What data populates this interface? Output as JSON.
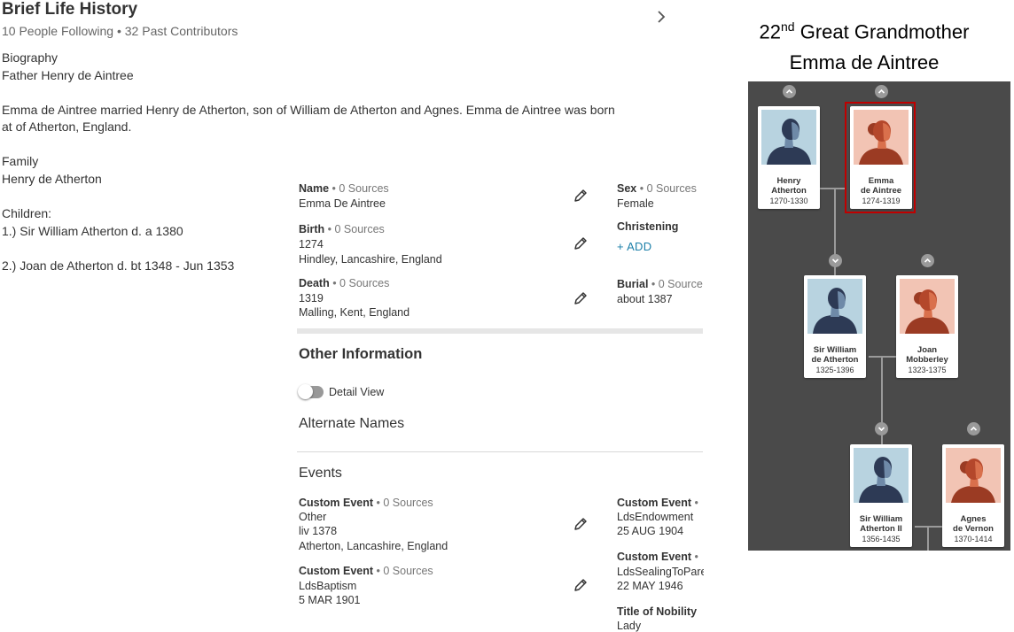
{
  "header": {
    "title": "Brief Life History",
    "subtitle": "10 People Following • 32 Past Contributors"
  },
  "bio": {
    "lines": [
      "Biography",
      "Father Henry de Aintree",
      "Emma de Aintree married Henry de Atherton, son of William de Atherton and Agnes. Emma de Aintree was born",
      "at of Atherton, England.",
      "Family",
      "Henry de Atherton",
      "Children:",
      "1.) Sir William Atherton d. a 1380",
      "2.) Joan de Atherton d. bt 1348 - Jun 1353"
    ]
  },
  "vitals": {
    "name": {
      "label": "Name",
      "sources": " • 0 Sources",
      "value": "Emma De Aintree"
    },
    "birth": {
      "label": "Birth",
      "sources": " • 0 Sources",
      "date": "1274",
      "place": "Hindley, Lancashire, England"
    },
    "death": {
      "label": "Death",
      "sources": " • 0 Sources",
      "date": "1319",
      "place": "Malling, Kent, England"
    },
    "sex": {
      "label": "Sex",
      "sources": " • 0 Sources",
      "value": "Female"
    },
    "christening": {
      "label": "Christening",
      "add": "+  ADD"
    },
    "burial": {
      "label": "Burial",
      "sources": " • 0 Source",
      "value": "about 1387"
    }
  },
  "other": {
    "heading": "Other Information",
    "detail_view": "Detail View",
    "alternate_names": "Alternate Names",
    "events_heading": "Events",
    "events_left": [
      {
        "label": "Custom Event",
        "sources": " • 0 Sources",
        "lines": [
          "Other",
          "liv 1378",
          "Atherton, Lancashire, England"
        ]
      },
      {
        "label": "Custom Event",
        "sources": " • 0 Sources",
        "lines": [
          "LdsBaptism",
          "5 MAR 1901"
        ]
      }
    ],
    "events_right": [
      {
        "label": "Custom Event",
        "sources": " •",
        "lines": [
          "LdsEndowment",
          "25 AUG 1904"
        ]
      },
      {
        "label": "Custom Event",
        "sources": " •",
        "lines": [
          "LdsSealingToPare",
          "22 MAY 1946"
        ]
      },
      {
        "label": "Title of Nobility",
        "sources": "",
        "lines": [
          "Lady"
        ]
      }
    ]
  },
  "overlay": {
    "line1_pre": "22",
    "line1_sup": "nd",
    "line1_post": " Great Grandmother",
    "line2": "Emma de Aintree"
  },
  "tree": {
    "people": [
      {
        "name1": "Henry",
        "name2": "Atherton",
        "dates": "1270-1330"
      },
      {
        "name1": "Emma",
        "name2": "de Aintree",
        "dates": "1274-1319"
      },
      {
        "name1": "Sir William",
        "name2": "de Atherton",
        "dates": "1325-1396"
      },
      {
        "name1": "Joan",
        "name2": "Mobberley",
        "dates": "1323-1375"
      },
      {
        "name1": "Sir William",
        "name2": "Atherton II",
        "dates": "1356-1435"
      },
      {
        "name1": "Agnes",
        "name2": "de Vernon",
        "dates": "1370-1414"
      }
    ],
    "colors": {
      "bg": "#4a4a4a",
      "highlight": "#c00000",
      "male_bg": "#b8d3e0",
      "female_bg": "#f2c4b4"
    }
  }
}
